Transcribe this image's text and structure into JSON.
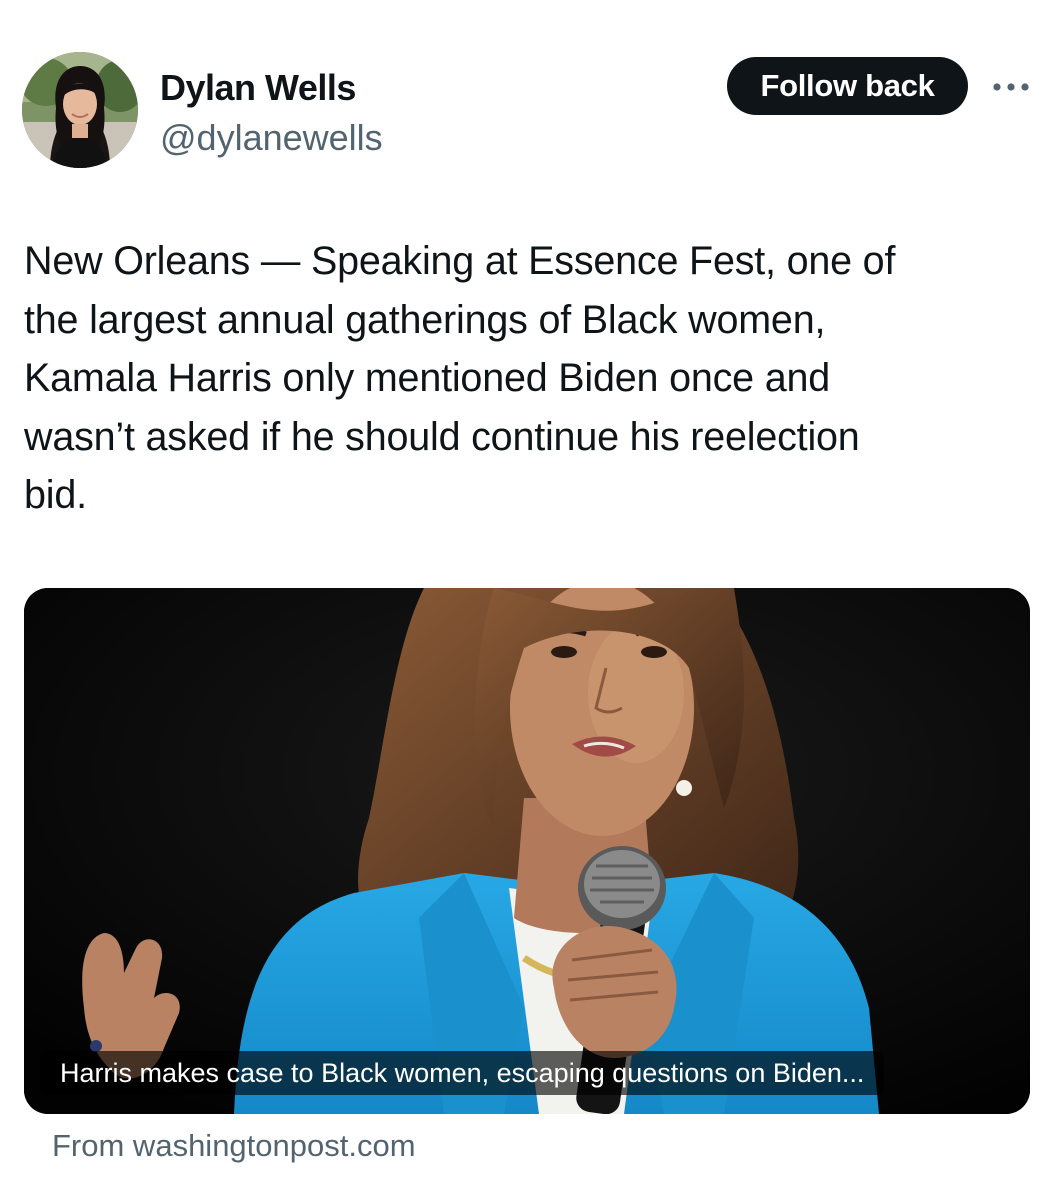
{
  "author": {
    "display_name": "Dylan Wells",
    "handle": "@dylanewells"
  },
  "actions": {
    "follow_label": "Follow back"
  },
  "tweet": {
    "lines": [
      "New Orleans — Speaking at Essence Fest, one of",
      "the largest annual gatherings of Black women,",
      "Kamala Harris only mentioned Biden once and",
      "wasn’t asked if he should continue his reelection",
      "bid."
    ]
  },
  "link_card": {
    "title": "Harris makes case to Black women, escaping questions on Biden...",
    "source": "From washingtonpost.com"
  },
  "icons": {
    "more": "more-horizontal-icon"
  },
  "colors": {
    "text": "#0f1419",
    "secondary": "#536471",
    "button_bg": "#0f1419",
    "jacket_blue": "#1d9ad6"
  }
}
